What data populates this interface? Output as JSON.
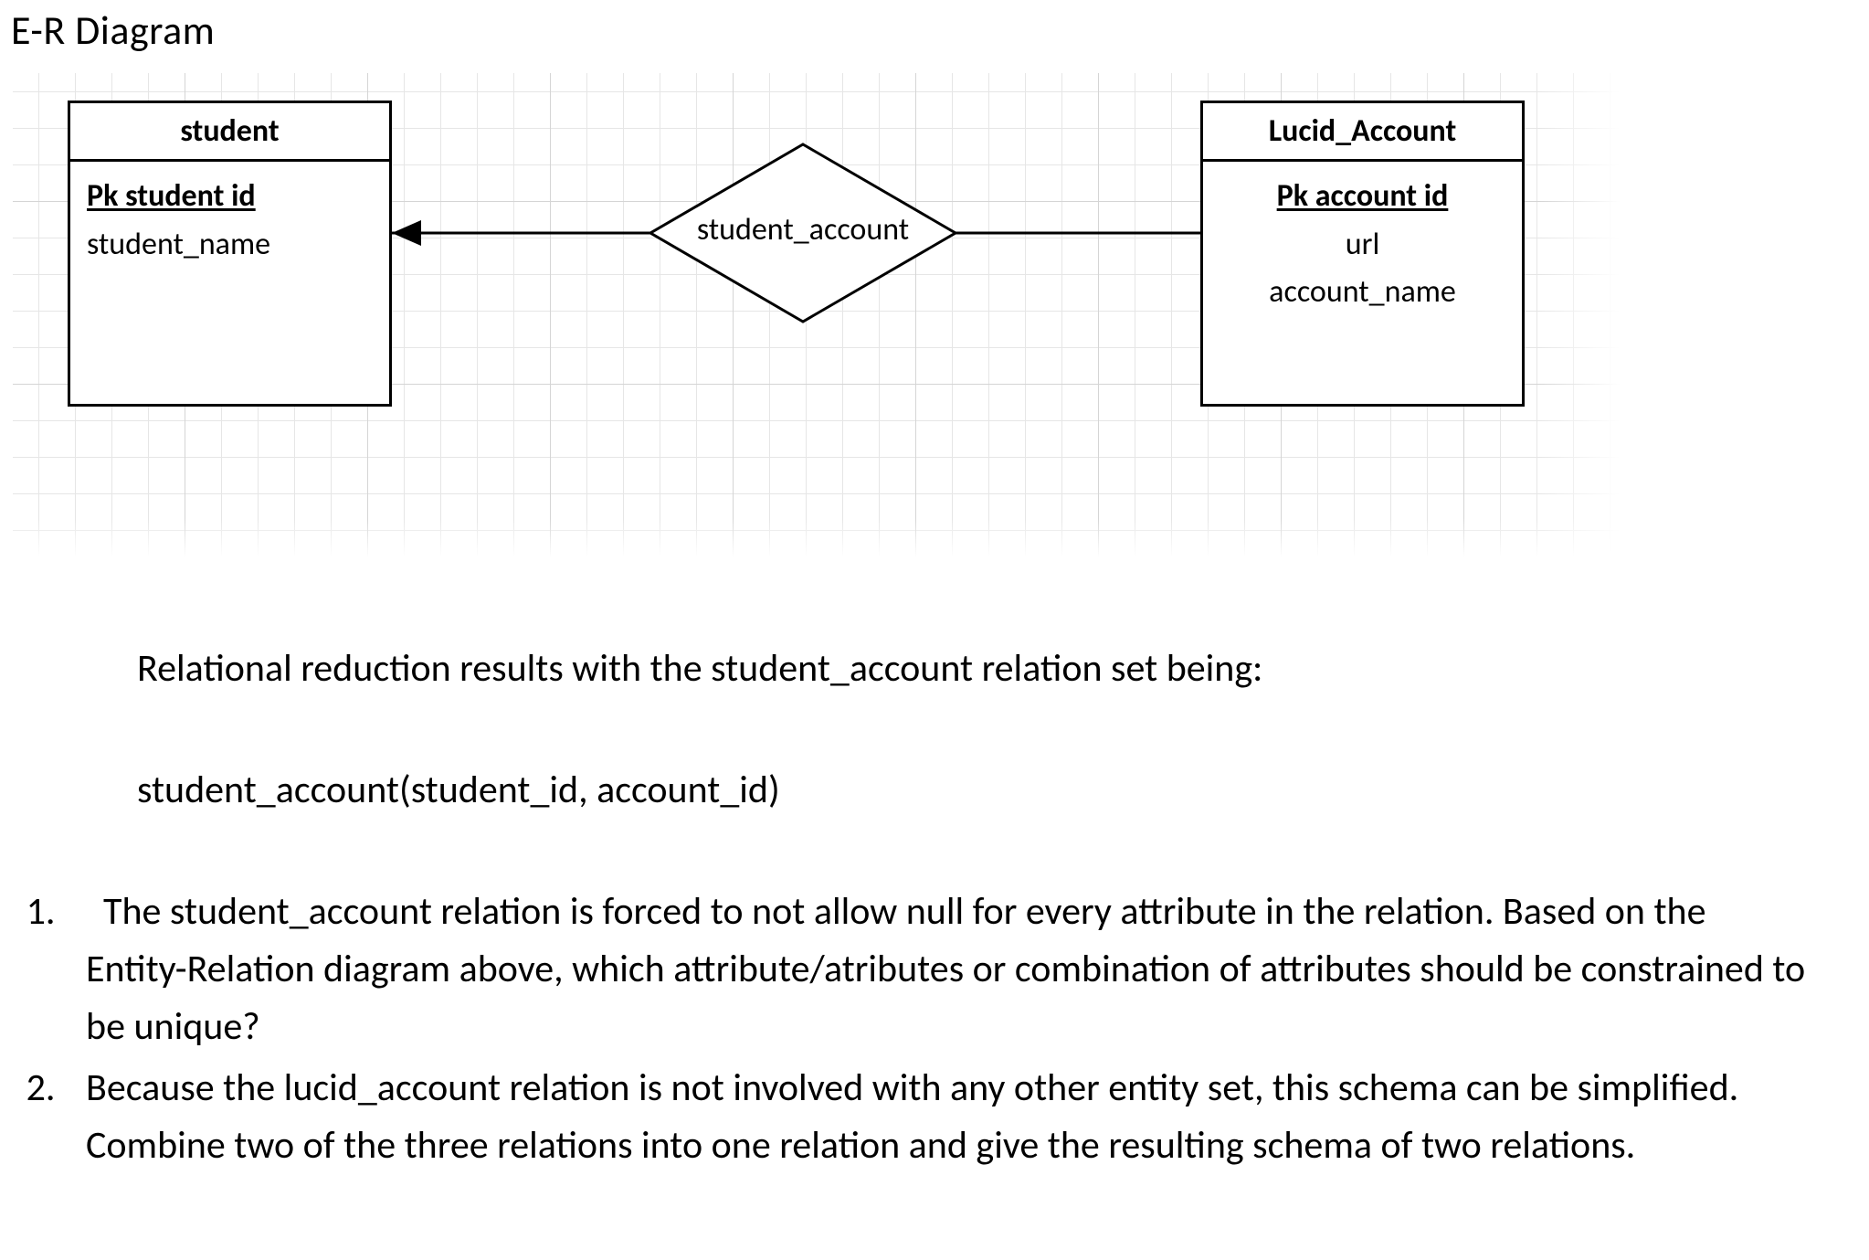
{
  "title": "E-R Diagram",
  "entities": {
    "student": {
      "name": "student",
      "pk": "Pk  student  id",
      "attrs": [
        "student_name"
      ]
    },
    "lucid_account": {
      "name": "Lucid_Account",
      "pk": "Pk  account  id",
      "attrs": [
        "url",
        "account_name"
      ]
    }
  },
  "relationship": {
    "name": "student_account"
  },
  "body": {
    "intro": "Relational reduction results with the student_account relation set being:",
    "schema": "student_account(student_id, account_id)",
    "q1": "The student_account relation is forced to not allow null for every attribute in the relation. Based on the Entity-Relation diagram above, which attribute/atributes or combination of attributes should be constrained to be unique?",
    "q2": "Because the lucid_account relation is not involved with any other entity set, this schema can be simplified. Combine two of the three relations into one relation and give the resulting schema of two relations."
  }
}
